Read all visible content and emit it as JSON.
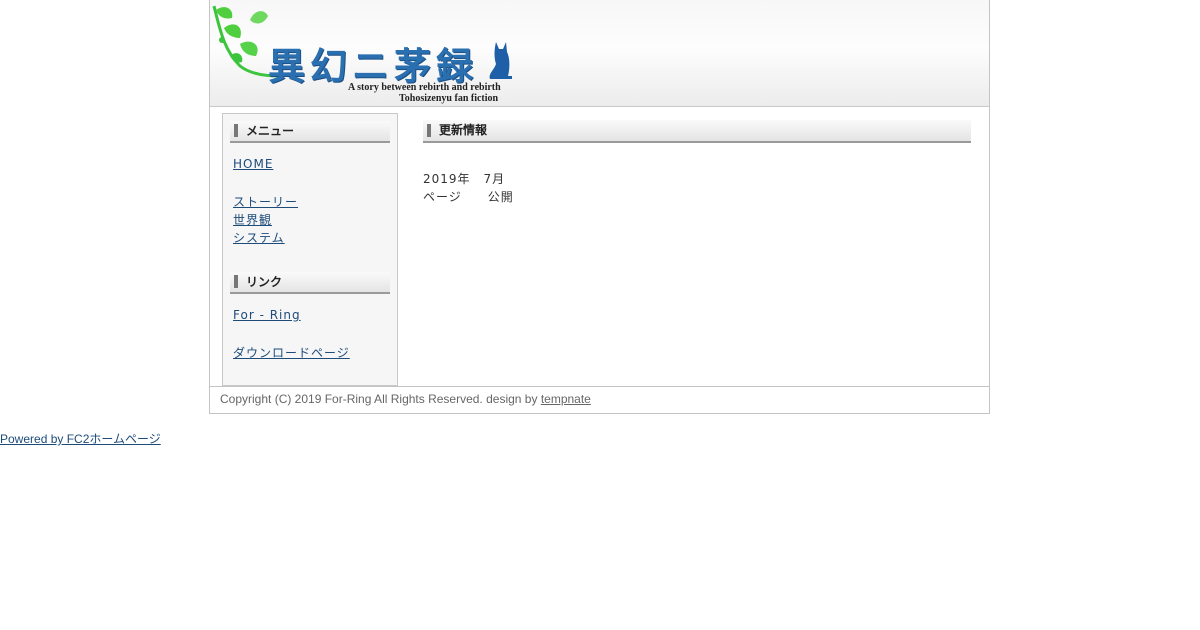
{
  "header": {
    "title": "異幻ニ茅録",
    "subtitle_line1": "A story between rebirth and rebirth",
    "subtitle_line2": "Tohosizenyu fan fiction",
    "accent_color": "#2a6fb0",
    "leaf_color": "#3cc53c"
  },
  "sidebar": {
    "menu_heading": "メニュー",
    "menu_items": [
      "HOME",
      "ストーリー",
      "世界観",
      "システム"
    ],
    "link_heading": "リンク",
    "link_items": [
      "For - Ring",
      "ダウンロードページ"
    ]
  },
  "main": {
    "heading": "更新情報",
    "update_date": "2019年　7月",
    "update_text": "ページ　　公開"
  },
  "footer": {
    "copyright": "Copyright (C) 2019 For-Ring All Rights Reserved. design by ",
    "designer_link": "tempnate"
  },
  "powered_by": "Powered by FC2ホームページ"
}
